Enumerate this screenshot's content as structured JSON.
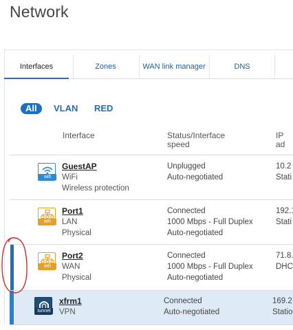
{
  "page": {
    "title": "Network"
  },
  "tabs": [
    {
      "label": "Interfaces",
      "active": true
    },
    {
      "label": "Zones",
      "active": false
    },
    {
      "label": "WAN link manager",
      "active": false
    },
    {
      "label": "DNS",
      "active": false
    }
  ],
  "filters": [
    {
      "label": "All",
      "active": true
    },
    {
      "label": "VLAN",
      "active": false
    },
    {
      "label": "RED",
      "active": false
    }
  ],
  "columns": {
    "interface": "Interface",
    "status": "Status/Interface speed",
    "ip": "IP ad"
  },
  "rows": [
    {
      "name": "GuestAP",
      "type": "WiFi",
      "detail": "Wireless protection",
      "icon": "wifi-icon",
      "icon_label": "wifi",
      "status": "Unplugged",
      "speed": "Auto-negotiated",
      "speed2": "",
      "ip": "10.2",
      "ip2": "Stati"
    },
    {
      "name": "Port1",
      "type": "LAN",
      "detail": "Physical",
      "icon": "ethernet-icon",
      "icon_label": "eth",
      "status": "Connected",
      "speed": "1000 Mbps - Full Duplex",
      "speed2": "Auto-negotiated",
      "ip": "192.1",
      "ip2": "Stati"
    },
    {
      "name": "Port2",
      "type": "WAN",
      "detail": "Physical",
      "icon": "ethernet-icon",
      "icon_label": "eth",
      "status": "Connected",
      "speed": "1000 Mbps - Full Duplex",
      "speed2": "Auto-negotiated",
      "ip": "71.8.",
      "ip2": "DHC"
    },
    {
      "name": "xfrm1",
      "type": "VPN",
      "detail": "",
      "icon": "tunnel-icon",
      "icon_label": "tunnel",
      "status": "Connected",
      "speed": "Auto-negotiated",
      "speed2": "",
      "ip": "169.2",
      "ip2": "Statio"
    }
  ],
  "colors": {
    "accent": "#1e6fc0",
    "selected_row": "#deebf7",
    "annotation": "#d9262b",
    "eth_icon": "#e2a12b",
    "wifi_icon": "#2d8bd6"
  }
}
